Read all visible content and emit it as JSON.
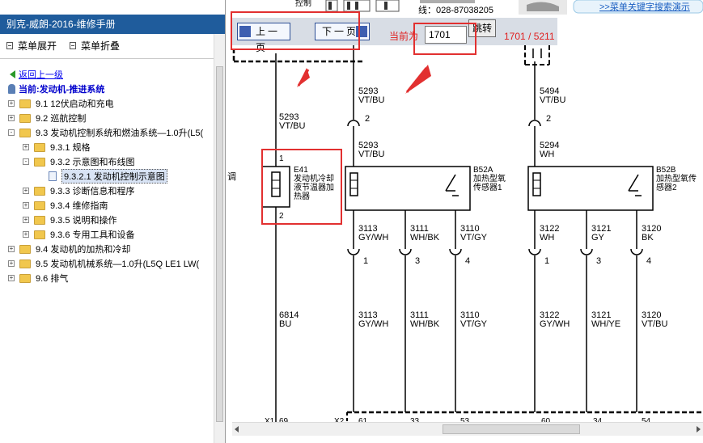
{
  "window": {
    "title": "别克-威朗-2016-维修手册"
  },
  "menu_ops": {
    "expand": "菜单展开",
    "collapse": "菜单折叠"
  },
  "nav": {
    "back": "返回上一级",
    "current": "当前:发动机-推进系统"
  },
  "tree": [
    {
      "label": "9.1 12伏启动和充电",
      "level": 0,
      "toggle": "+",
      "type": "folder"
    },
    {
      "label": "9.2 巡航控制",
      "level": 0,
      "toggle": "+",
      "type": "folder"
    },
    {
      "label": "9.3 发动机控制系统和燃油系统—1.0升(L5(",
      "level": 0,
      "toggle": "-",
      "type": "folder"
    },
    {
      "label": "9.3.1 规格",
      "level": 1,
      "toggle": "+",
      "type": "folder"
    },
    {
      "label": "9.3.2 示意图和布线图",
      "level": 1,
      "toggle": "-",
      "type": "folder"
    },
    {
      "label": "9.3.2.1 发动机控制示意图",
      "level": 2,
      "toggle": "",
      "type": "doc",
      "selected": true
    },
    {
      "label": "9.3.3 诊断信息和程序",
      "level": 1,
      "toggle": "+",
      "type": "folder"
    },
    {
      "label": "9.3.4 维修指南",
      "level": 1,
      "toggle": "+",
      "type": "folder"
    },
    {
      "label": "9.3.5 说明和操作",
      "level": 1,
      "toggle": "+",
      "type": "folder"
    },
    {
      "label": "9.3.6 专用工具和设备",
      "level": 1,
      "toggle": "+",
      "type": "folder"
    },
    {
      "label": "9.4 发动机的加热和冷却",
      "level": 0,
      "toggle": "+",
      "type": "folder"
    },
    {
      "label": "9.5 发动机机械系统—1.0升(L5Q LE1 LW(",
      "level": 0,
      "toggle": "+",
      "type": "folder"
    },
    {
      "label": "9.6 排气",
      "level": 0,
      "toggle": "+",
      "type": "folder"
    }
  ],
  "toolbar": {
    "prev_label": "上一页",
    "next_label": "下一页",
    "current_label": "当前为",
    "page_value": "1701",
    "jump_label": "跳转",
    "page_count": "1701 / 5211"
  },
  "header_fragments": {
    "control": "控制",
    "phone": "线：028-87038205",
    "search_link": ">>菜单关键字搜索演示"
  },
  "diagram": {
    "left_edge_text": "调",
    "wires": {
      "w1_top": "5293",
      "w1_top_c": "VT/BU",
      "w1_mid": "5293",
      "w1_mid_c": "VT/BU",
      "w2_top": "5293",
      "w2_top_c": "VT/BU",
      "w3_top": "5494",
      "w3_top_c": "VT/BU",
      "w3_mid": "5294",
      "w3_mid_c": "WH",
      "w4": "6814",
      "w4_c": "BU"
    },
    "pins": {
      "p2a": "2",
      "p2b": "2",
      "p1": "1",
      "p2c": "2"
    },
    "components": {
      "e41_ref": "E41",
      "e41_l1": "发动机冷却",
      "e41_l2": "液节温器加",
      "e41_l3": "热器",
      "b52a_ref": "B52A",
      "b52a_l1": "加热型氧",
      "b52a_l2": "传感器1",
      "b52b_ref": "B52B",
      "b52b_l1": "加热型氧传",
      "b52b_l2": "感器2"
    },
    "sensor_wires_a": [
      {
        "num": "3113",
        "color": "GY/WH",
        "pin": "1",
        "num2": "3113",
        "color2": "GY/WH"
      },
      {
        "num": "3111",
        "color": "WH/BK",
        "pin": "3",
        "num2": "3111",
        "color2": "WH/BK"
      },
      {
        "num": "3110",
        "color": "VT/GY",
        "pin": "4",
        "num2": "3110",
        "color2": "VT/GY"
      }
    ],
    "sensor_wires_b": [
      {
        "num": "3122",
        "color": "WH",
        "pin": "1",
        "num2": "3122",
        "color2": "GY/WH"
      },
      {
        "num": "3121",
        "color": "GY",
        "pin": "3",
        "num2": "3121",
        "color2": "WH/YE"
      },
      {
        "num": "3120",
        "color": "BK",
        "pin": "4",
        "num2": "3120",
        "color2": "VT/BU"
      }
    ],
    "bottom": {
      "x1": "X1",
      "x1p": "69",
      "x2": "X2",
      "p61": "61",
      "p33": "33",
      "p53": "53",
      "p60": "60",
      "p34": "34",
      "p54": "54"
    }
  },
  "colors": {
    "title_bar": "#1f5c9c",
    "annotation": "#e23030",
    "link": "#0000ee"
  }
}
